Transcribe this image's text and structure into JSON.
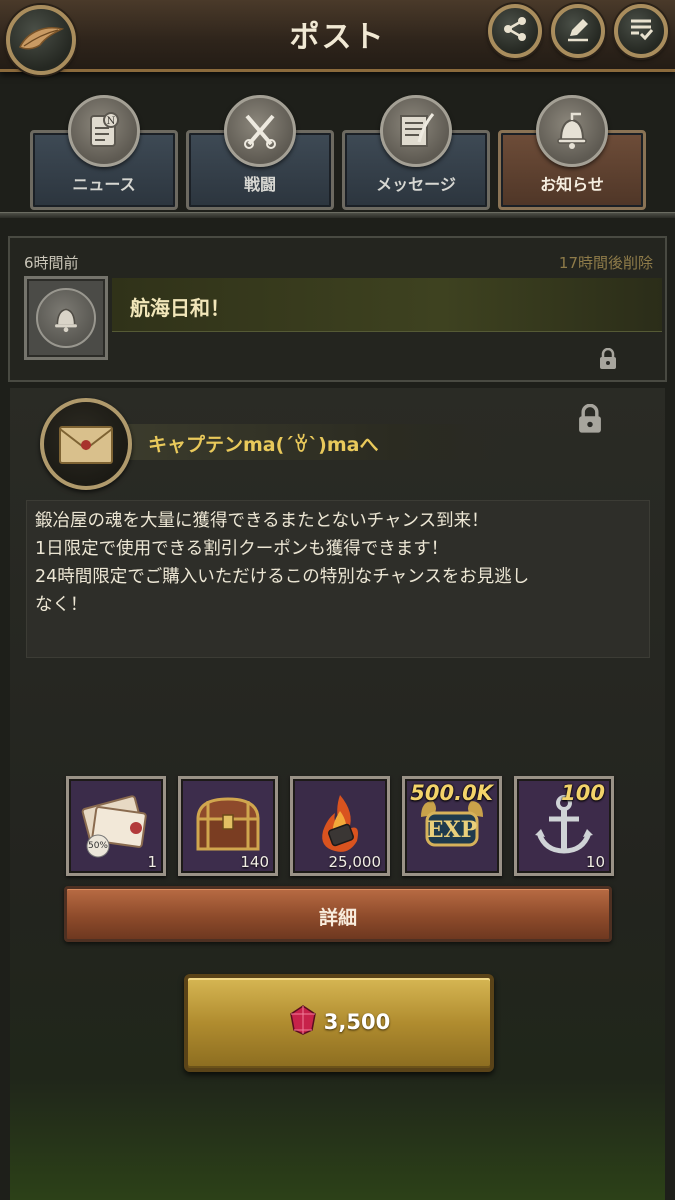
{
  "header": {
    "title": "ポスト",
    "back_icon": "feather-icon",
    "share_icon": "share-icon",
    "edit_icon": "pencil-icon",
    "bulk_icon": "list-check-icon"
  },
  "tabs": [
    {
      "label": "ニュース",
      "icon": "scroll-icon",
      "active": false
    },
    {
      "label": "戦闘",
      "icon": "crossed-swords-icon",
      "active": false
    },
    {
      "label": "メッセージ",
      "icon": "letter-quill-icon",
      "active": false
    },
    {
      "label": "お知らせ",
      "icon": "bell-icon",
      "active": true
    }
  ],
  "notice": {
    "time_ago": "6時間前",
    "expiry": "17時間後削除",
    "title": "航海日和！",
    "icon": "bell-icon"
  },
  "message": {
    "to": "キャプテンma(´ꈊ`)maへ",
    "icon": "envelope-icon",
    "lines": [
      "鍛冶屋の魂を大量に獲得できるまたとないチャンス到来！",
      "1日限定で使用できる割引クーポンも獲得できます！",
      "24時間限定でご購入いただけるこの特別なチャンスをお見逃し",
      "なく！"
    ]
  },
  "items": [
    {
      "icon": "discount-coupon-icon",
      "count": "1",
      "badge": "",
      "coupon_label": "50%"
    },
    {
      "icon": "treasure-chest-icon",
      "count": "140",
      "badge": ""
    },
    {
      "icon": "blacksmith-soul-icon",
      "count": "25,000",
      "badge": ""
    },
    {
      "icon": "exp-icon",
      "count": "",
      "badge": "500.0K",
      "exp_label": "EXP"
    },
    {
      "icon": "anchor-icon",
      "count": "10",
      "badge": "100"
    }
  ],
  "buttons": {
    "detail_label": "詳細",
    "buy_price": "3,500",
    "buy_icon": "ruby-gem-icon"
  },
  "colors": {
    "accent_gold": "#e9c95b",
    "active_tab": "#6e4d39",
    "detail_button": "#a45a36",
    "buy_button": "#c4a23f"
  }
}
